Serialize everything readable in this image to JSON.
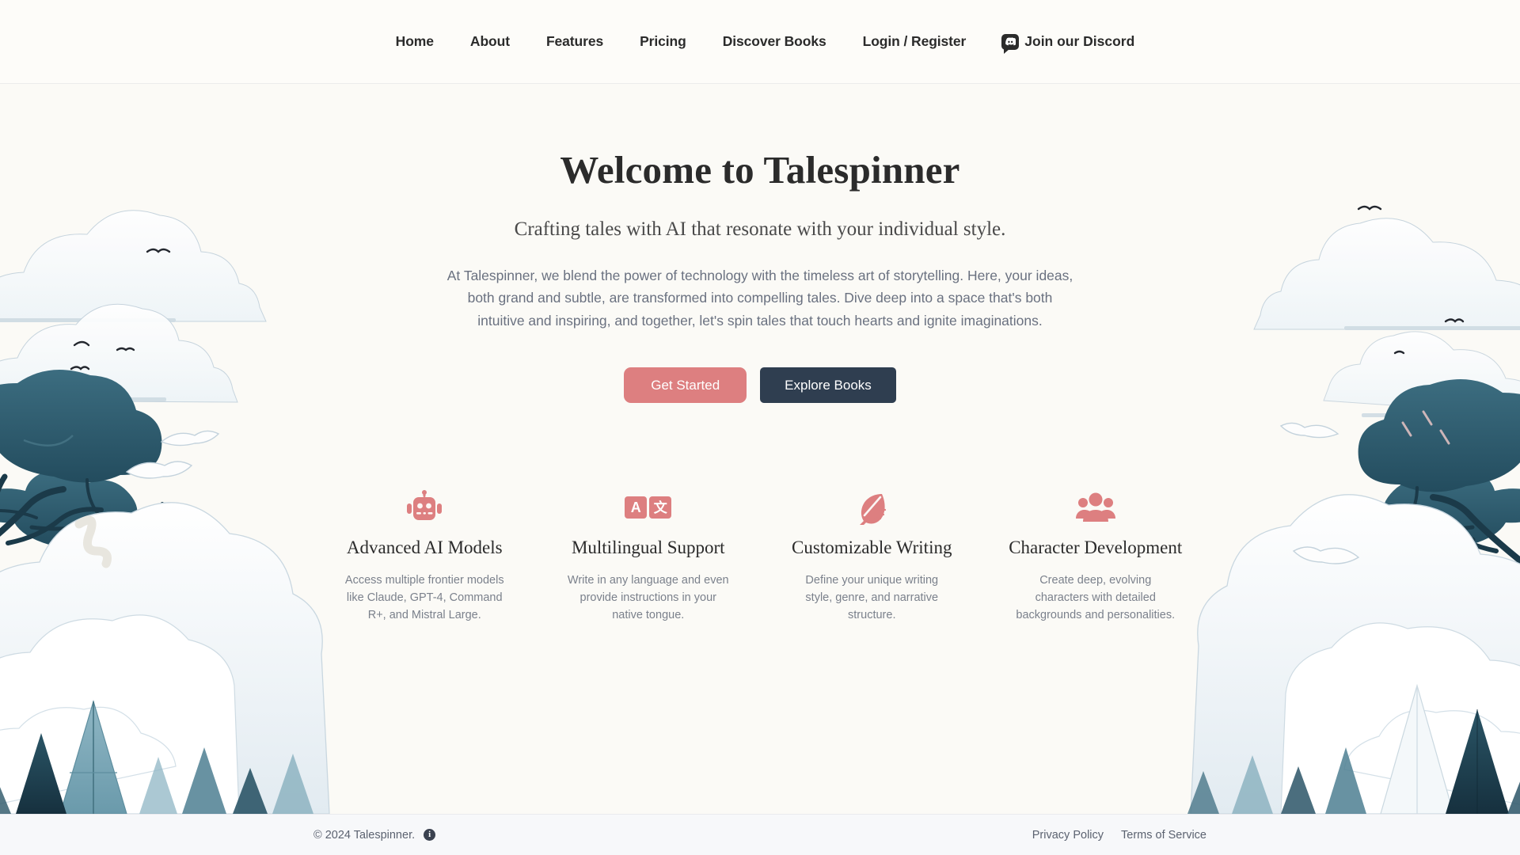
{
  "nav": {
    "links": [
      {
        "label": "Home"
      },
      {
        "label": "About"
      },
      {
        "label": "Features"
      },
      {
        "label": "Pricing"
      },
      {
        "label": "Discover Books"
      },
      {
        "label": "Login / Register"
      }
    ],
    "discord": {
      "label": "Join our Discord",
      "icon": "discord-icon"
    }
  },
  "hero": {
    "title": "Welcome to Talespinner",
    "subtitle": "Crafting tales with AI that resonate with your individual style.",
    "body": "At Talespinner, we blend the power of technology with the timeless art of storytelling. Here, your ideas, both grand and subtle, are transformed into compelling tales. Dive deep into a space that's both intuitive and inspiring, and together, let's spin tales that touch hearts and ignite imaginations.",
    "primary_cta": "Get Started",
    "secondary_cta": "Explore Books"
  },
  "features": [
    {
      "icon": "robot-icon",
      "title": "Advanced AI Models",
      "description": "Access multiple frontier models like Claude, GPT-4, Command R+, and Mistral Large."
    },
    {
      "icon": "translate-icon",
      "title": "Multilingual Support",
      "description": "Write in any language and even provide instructions in your native tongue.",
      "glyph_latin": "A",
      "glyph_cjk": "文"
    },
    {
      "icon": "feather-icon",
      "title": "Customizable Writing",
      "description": "Define your unique writing style, genre, and narrative structure."
    },
    {
      "icon": "people-group-icon",
      "title": "Character Development",
      "description": "Create deep, evolving characters with detailed backgrounds and personalities."
    }
  ],
  "footer": {
    "copyright": "© 2024 Talespinner.",
    "info_glyph": "i",
    "links": [
      {
        "label": "Privacy Policy"
      },
      {
        "label": "Terms of Service"
      }
    ]
  },
  "colors": {
    "accent": "#dd7f80",
    "dark": "#2f3e50",
    "page_bg": "#fbfaf6",
    "nav_bg": "#fdfcf9",
    "footer_bg": "#f7f8fa",
    "foliage_dark": "#2f5d6e",
    "foliage_deep": "#1d3b4a",
    "cloud": "#ffffff",
    "cloud_shade": "#dfe8ee"
  }
}
